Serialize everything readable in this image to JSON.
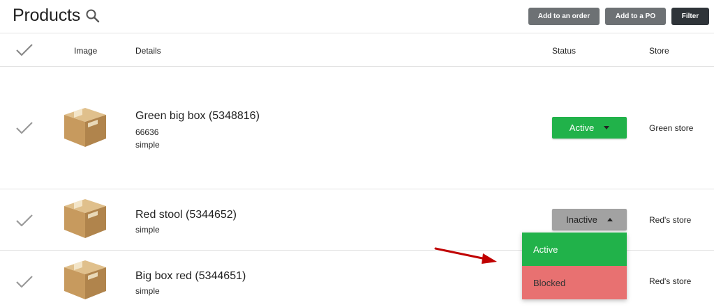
{
  "header": {
    "title": "Products",
    "buttons": {
      "add_to_order": "Add to an order",
      "add_to_po": "Add to a PO",
      "filter": "Filter"
    }
  },
  "columns": {
    "image": "Image",
    "details": "Details",
    "status": "Status",
    "store": "Store"
  },
  "rows": [
    {
      "name": "Green big box (5348816)",
      "lines": [
        "66636",
        "simple"
      ],
      "status": "Active",
      "store": "Green store"
    },
    {
      "name": "Red stool (5344652)",
      "lines": [
        "simple"
      ],
      "status": "Inactive",
      "store": "Red's store"
    },
    {
      "name": "Big box red (5344651)",
      "lines": [
        "simple"
      ],
      "status": "",
      "store": "Red's store"
    }
  ],
  "dropdown": {
    "options": [
      "Active",
      "Blocked"
    ]
  },
  "colors": {
    "active": "#21b24a",
    "inactive": "#a2a2a2",
    "blocked": "#e87171",
    "button_dark": "#2f3439",
    "button_gray": "#6d7174",
    "arrow": "#c00000"
  },
  "icons": [
    "search-icon",
    "checkmark-icon",
    "product-box-icon",
    "caret-down-icon",
    "caret-up-icon",
    "arrow-annotation"
  ]
}
